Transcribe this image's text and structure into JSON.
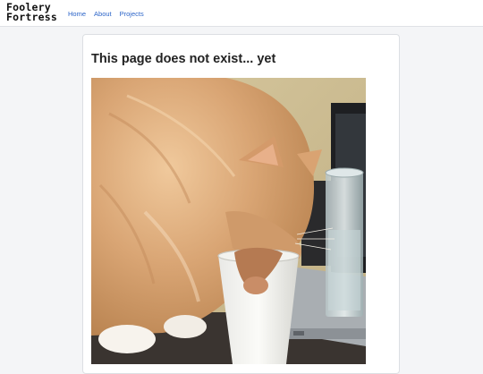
{
  "header": {
    "logo_line1": "Foolery",
    "logo_line2": "Fortress",
    "nav": [
      {
        "label": "Home"
      },
      {
        "label": "About"
      },
      {
        "label": "Projects"
      }
    ]
  },
  "main": {
    "title": "This page does not exist... yet",
    "image_subject": "cat-drinking-from-paper-cup"
  },
  "colors": {
    "link": "#2b64c8",
    "page_bg": "#f4f5f7"
  }
}
